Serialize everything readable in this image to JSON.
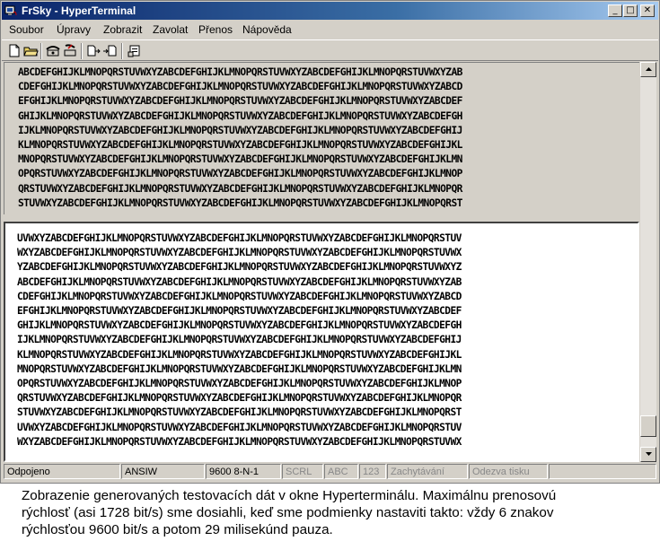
{
  "window": {
    "title": "FrSky - HyperTerminal",
    "controls": {
      "minimize": "_",
      "maximize": "□",
      "close": "✕"
    }
  },
  "menu": [
    "Soubor",
    "Úpravy",
    "Zobrazit",
    "Zavolat",
    "Přenos",
    "Nápověda"
  ],
  "toolbar": [
    "new-file-icon",
    "open-folder-icon",
    "connect-phone-icon",
    "disconnect-phone-icon",
    "send-file-icon",
    "receive-file-icon",
    "properties-icon"
  ],
  "terminal_top": [
    "ABCDEFGHIJKLMNOPQRSTUVWXYZABCDEFGHIJKLMNOPQRSTUVWXYZABCDEFGHIJKLMNOPQRSTUVWXYZAB",
    "CDEFGHIJKLMNOPQRSTUVWXYZABCDEFGHIJKLMNOPQRSTUVWXYZABCDEFGHIJKLMNOPQRSTUVWXYZABCD",
    "EFGHIJKLMNOPQRSTUVWXYZABCDEFGHIJKLMNOPQRSTUVWXYZABCDEFGHIJKLMNOPQRSTUVWXYZABCDEF",
    "GHIJKLMNOPQRSTUVWXYZABCDEFGHIJKLMNOPQRSTUVWXYZABCDEFGHIJKLMNOPQRSTUVWXYZABCDEFGH",
    "IJKLMNOPQRSTUVWXYZABCDEFGHIJKLMNOPQRSTUVWXYZABCDEFGHIJKLMNOPQRSTUVWXYZABCDEFGHIJ",
    "KLMNOPQRSTUVWXYZABCDEFGHIJKLMNOPQRSTUVWXYZABCDEFGHIJKLMNOPQRSTUVWXYZABCDEFGHIJKL",
    "MNOPQRSTUVWXYZABCDEFGHIJKLMNOPQRSTUVWXYZABCDEFGHIJKLMNOPQRSTUVWXYZABCDEFGHIJKLMN",
    "OPQRSTUVWXYZABCDEFGHIJKLMNOPQRSTUVWXYZABCDEFGHIJKLMNOPQRSTUVWXYZABCDEFGHIJKLMNOP",
    "QRSTUVWXYZABCDEFGHIJKLMNOPQRSTUVWXYZABCDEFGHIJKLMNOPQRSTUVWXYZABCDEFGHIJKLMNOPQR",
    "STUVWXYZABCDEFGHIJKLMNOPQRSTUVWXYZABCDEFGHIJKLMNOPQRSTUVWXYZABCDEFGHIJKLMNOPQRST"
  ],
  "terminal_bottom": [
    "UVWXYZABCDEFGHIJKLMNOPQRSTUVWXYZABCDEFGHIJKLMNOPQRSTUVWXYZABCDEFGHIJKLMNOPQRSTUV",
    "WXYZABCDEFGHIJKLMNOPQRSTUVWXYZABCDEFGHIJKLMNOPQRSTUVWXYZABCDEFGHIJKLMNOPQRSTUVWX",
    "YZABCDEFGHIJKLMNOPQRSTUVWXYZABCDEFGHIJKLMNOPQRSTUVWXYZABCDEFGHIJKLMNOPQRSTUVWXYZ",
    "ABCDEFGHIJKLMNOPQRSTUVWXYZABCDEFGHIJKLMNOPQRSTUVWXYZABCDEFGHIJKLMNOPQRSTUVWXYZAB",
    "CDEFGHIJKLMNOPQRSTUVWXYZABCDEFGHIJKLMNOPQRSTUVWXYZABCDEFGHIJKLMNOPQRSTUVWXYZABCD",
    "EFGHIJKLMNOPQRSTUVWXYZABCDEFGHIJKLMNOPQRSTUVWXYZABCDEFGHIJKLMNOPQRSTUVWXYZABCDEF",
    "GHIJKLMNOPQRSTUVWXYZABCDEFGHIJKLMNOPQRSTUVWXYZABCDEFGHIJKLMNOPQRSTUVWXYZABCDEFGH",
    "IJKLMNOPQRSTUVWXYZABCDEFGHIJKLMNOPQRSTUVWXYZABCDEFGHIJKLMNOPQRSTUVWXYZABCDEFGHIJ",
    "KLMNOPQRSTUVWXYZABCDEFGHIJKLMNOPQRSTUVWXYZABCDEFGHIJKLMNOPQRSTUVWXYZABCDEFGHIJKL",
    "MNOPQRSTUVWXYZABCDEFGHIJKLMNOPQRSTUVWXYZABCDEFGHIJKLMNOPQRSTUVWXYZABCDEFGHIJKLMN",
    "OPQRSTUVWXYZABCDEFGHIJKLMNOPQRSTUVWXYZABCDEFGHIJKLMNOPQRSTUVWXYZABCDEFGHIJKLMNOP",
    "QRSTUVWXYZABCDEFGHIJKLMNOPQRSTUVWXYZABCDEFGHIJKLMNOPQRSTUVWXYZABCDEFGHIJKLMNOPQR",
    "STUVWXYZABCDEFGHIJKLMNOPQRSTUVWXYZABCDEFGHIJKLMNOPQRSTUVWXYZABCDEFGHIJKLMNOPQRST",
    "UVWXYZABCDEFGHIJKLMNOPQRSTUVWXYZABCDEFGHIJKLMNOPQRSTUVWXYZABCDEFGHIJKLMNOPQRSTUV",
    "WXYZABCDEFGHIJKLMNOPQRSTUVWXYZABCDEFGHIJKLMNOPQRSTUVWXYZABCDEFGHIJKLMNOPQRSTUVWX"
  ],
  "statusbar": {
    "connection": "Odpojeno",
    "emulation": "ANSIW",
    "settings": "9600 8-N-1",
    "scroll": "SCRL",
    "caps": "ABC",
    "num": "123",
    "capture": "Zachytávání",
    "print": "Odezva tisku"
  },
  "caption": [
    "Zobrazenie generovaných testovacích dát v okne Hyperterminálu. Maximálnu prenosovú",
    "rýchlosť (asi 1728 bit/s) sme dosiahli, keď sme podmienky nastaviti takto: vždy 6 znakov",
    "rýchlosťou 9600 bit/s a potom 29 milisekúnd pauza."
  ],
  "colors": {
    "titlebar_start": "#0a246a",
    "titlebar_end": "#a6caf0",
    "chrome": "#d4d0c8",
    "terminal_bg": "#ffffff"
  }
}
